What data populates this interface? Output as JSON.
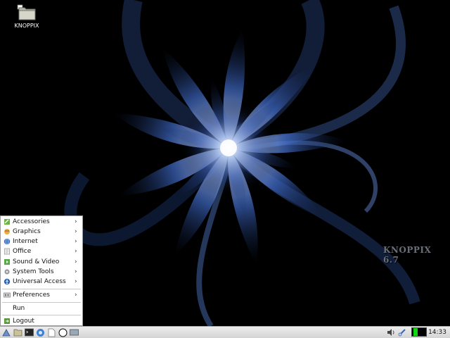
{
  "desktop": {
    "icons": [
      {
        "label": "KNOPPIX",
        "icon": "folder-icon"
      }
    ],
    "watermark": "KNOPPIX 6.7"
  },
  "start_menu": {
    "items": [
      {
        "label": "Accessories",
        "icon": "accessories-icon",
        "submenu": true
      },
      {
        "label": "Graphics",
        "icon": "graphics-icon",
        "submenu": true
      },
      {
        "label": "Internet",
        "icon": "internet-icon",
        "submenu": true
      },
      {
        "label": "Office",
        "icon": "office-icon",
        "submenu": true
      },
      {
        "label": "Sound & Video",
        "icon": "sound-video-icon",
        "submenu": true
      },
      {
        "label": "System Tools",
        "icon": "system-tools-icon",
        "submenu": true
      },
      {
        "label": "Universal Access",
        "icon": "universal-access-icon",
        "submenu": true
      },
      {
        "label": "Preferences",
        "icon": "preferences-icon",
        "submenu": true
      },
      {
        "label": "Run",
        "icon": "",
        "submenu": false
      },
      {
        "label": "Logout",
        "icon": "logout-icon",
        "submenu": false
      }
    ],
    "arrow": "›"
  },
  "taskbar": {
    "clock": "14:33",
    "launchers": [
      "start-menu-icon",
      "file-manager-icon",
      "terminal-icon",
      "browser-icon",
      "text-editor-icon",
      "knoppix-icon",
      "show-desktop-icon"
    ],
    "tray": [
      "volume-icon",
      "network-icon",
      "cpu-monitor-icon"
    ],
    "cpu_usage": 0.25
  },
  "colors": {
    "taskbar_bg": "#dcdcdc",
    "menu_bg": "#ffffff",
    "wallpaper_base": "#000000",
    "wallpaper_accent": "#3b63b8",
    "monitor_bar": "#11d611"
  }
}
